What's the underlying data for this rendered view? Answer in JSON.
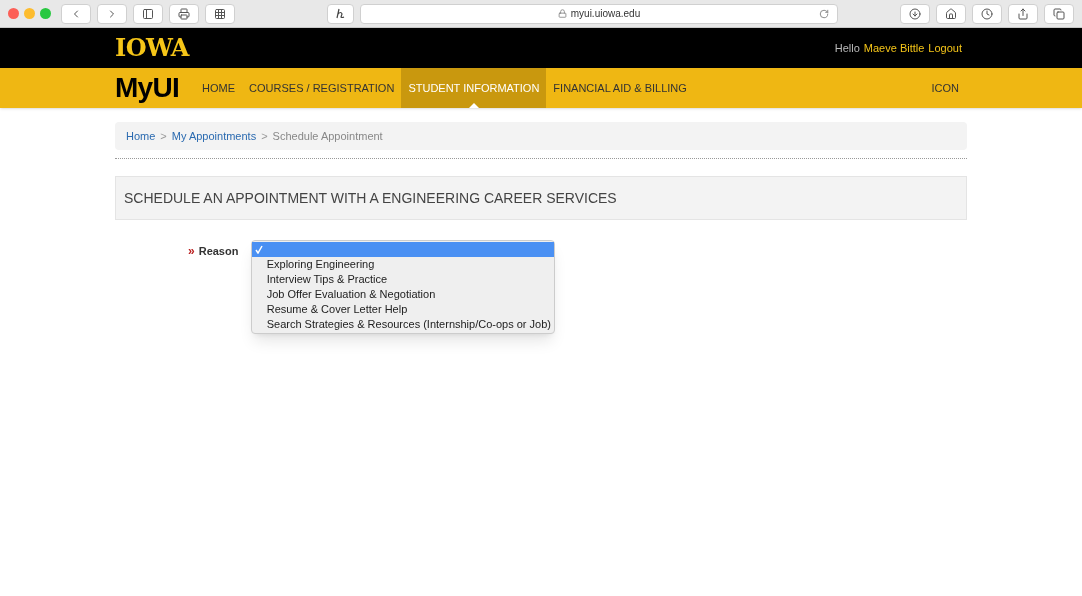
{
  "browser": {
    "address": "myui.uiowa.edu"
  },
  "header": {
    "wordmark": "IOWA",
    "greeting": "Hello",
    "user": "Maeve Bittle",
    "logout": "Logout"
  },
  "nav": {
    "logo": "MyUI",
    "items": [
      {
        "label": "HOME",
        "selected": false
      },
      {
        "label": "COURSES / REGISTRATION",
        "selected": false
      },
      {
        "label": "STUDENT INFORMATION",
        "selected": true
      },
      {
        "label": "FINANCIAL AID & BILLING",
        "selected": false
      }
    ],
    "right_item": "ICON"
  },
  "breadcrumb": [
    {
      "label": "Home",
      "kind": "link"
    },
    {
      "label": "My Appointments",
      "kind": "link"
    },
    {
      "label": "Schedule Appointment",
      "kind": "current"
    }
  ],
  "separator": ">",
  "page_title": "SCHEDULE AN APPOINTMENT WITH A ENGINEERING CAREER SERVICES",
  "form": {
    "marker": "»",
    "label": "Reason",
    "options": [
      {
        "selected": true
      },
      {
        "label": "Exploring Engineering",
        "selected": false
      },
      {
        "label": "Interview Tips & Practice",
        "selected": false
      },
      {
        "label": "Job Offer Evaluation & Negotiation",
        "selected": false
      },
      {
        "label": "Resume & Cover Letter Help",
        "selected": false
      },
      {
        "label": "Search Strategies & Resources (Internship/Co-ops or Job)",
        "selected": false
      }
    ]
  }
}
